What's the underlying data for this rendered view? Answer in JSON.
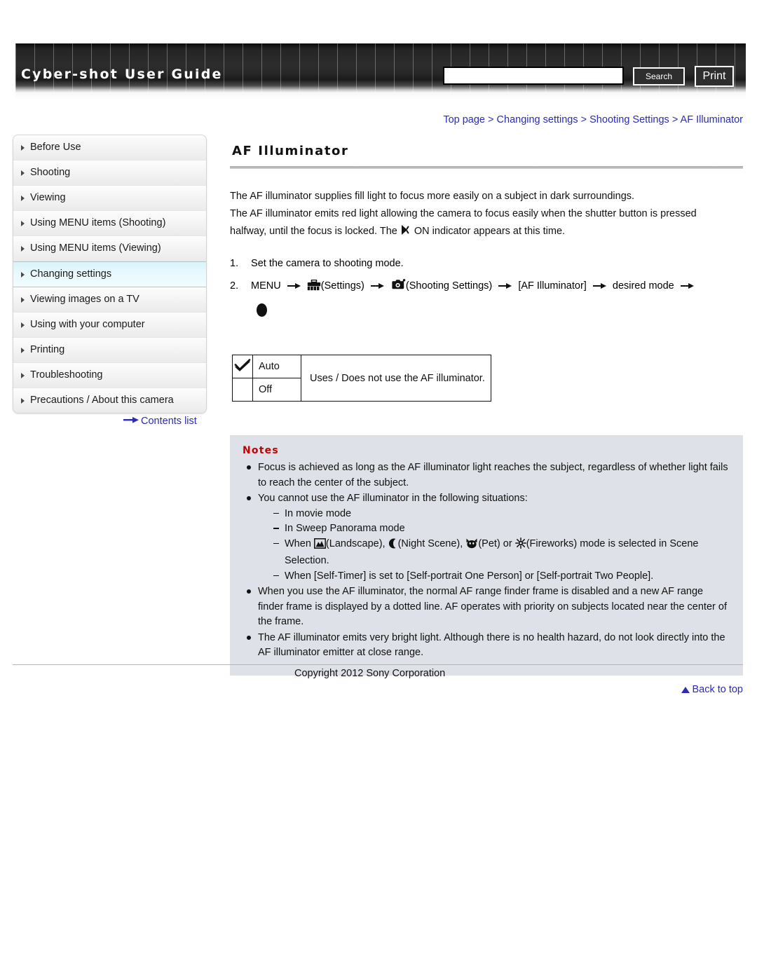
{
  "header": {
    "site_title": "Cyber-shot User Guide",
    "search_value": "",
    "search_placeholder": "",
    "search_button": "Search",
    "print_button": "Print"
  },
  "breadcrumb": {
    "items": [
      {
        "label": "Top page"
      },
      {
        "label": "Changing settings"
      },
      {
        "label": "Shooting Settings"
      },
      {
        "label": "AF Illuminator"
      }
    ],
    "separator": ">"
  },
  "sidebar": {
    "items": [
      {
        "label": "Before Use",
        "active": false
      },
      {
        "label": "Shooting",
        "active": false
      },
      {
        "label": "Viewing",
        "active": false
      },
      {
        "label": "Using MENU items (Shooting)",
        "active": false
      },
      {
        "label": "Using MENU items (Viewing)",
        "active": false
      },
      {
        "label": "Changing settings",
        "active": true
      },
      {
        "label": "Viewing images on a TV",
        "active": false
      },
      {
        "label": "Using with your computer",
        "active": false
      },
      {
        "label": "Printing",
        "active": false
      },
      {
        "label": "Troubleshooting",
        "active": false
      },
      {
        "label": "Precautions / About this camera",
        "active": false
      }
    ],
    "contents_link": "Contents list"
  },
  "main": {
    "title": "AF Illuminator",
    "paragraph_1": "The AF illuminator supplies fill light to focus more easily on a subject in dark surroundings.",
    "paragraph_2": "The AF illuminator emits red light allowing the camera to focus easily when the shutter button is pressed",
    "paragraph_3_before": "halfway, until the focus is locked. The",
    "paragraph_3_icon_label": "ON",
    "paragraph_3_after": "indicator appears at this time.",
    "steps": [
      {
        "number": "1.",
        "text": "Set the camera to shooting mode."
      },
      {
        "number": "2.",
        "menu_label": "MENU",
        "settings_label": "(Settings)",
        "shooting_settings_label": "(Shooting Settings)",
        "item_label": "[AF Illuminator]",
        "desired_mode_label": "desired mode"
      }
    ],
    "options_table": {
      "rows": [
        {
          "checked": true,
          "name": "Auto"
        },
        {
          "checked": false,
          "name": "Off"
        }
      ],
      "description": "Uses / Does not use the AF illuminator."
    },
    "notes": {
      "title": "Notes",
      "items": [
        {
          "text": "Focus is achieved as long as the AF illuminator light reaches the subject, regardless of whether light fails to reach the center of the subject.",
          "sub_items": []
        },
        {
          "text": "You cannot use the AF illuminator in the following situations:",
          "sub_items": [
            {
              "text": "In movie mode"
            },
            {
              "text": "In Sweep Panorama mode"
            },
            {
              "rich": true,
              "before": "When",
              "icon1_label": "(Landscape),",
              "icon2_label": "(Night Scene),",
              "icon3_label": "(Pet) or",
              "icon4_label": "(Fireworks) mode is selected in Scene",
              "after": "Selection."
            },
            {
              "text": "When [Self-Timer] is set to [Self-portrait One Person] or [Self-portrait Two People]."
            }
          ]
        },
        {
          "text": "When you use the AF illuminator, the normal AF range finder frame is disabled and a new AF range finder frame is displayed by a dotted line. AF operates with priority on subjects located near the center of the frame.",
          "sub_items": []
        },
        {
          "text": "The AF illuminator emits very bright light. Although there is no health hazard, do not look directly into the AF illuminator emitter at close range.",
          "sub_items": []
        }
      ]
    }
  },
  "footer": {
    "back_to_top": "Back to top",
    "copyright": "Copyright 2012 Sony Corporation"
  },
  "colors": {
    "link": "#2b2bb5",
    "notes_title": "#c30000",
    "notes_bg": "#dfe1e8",
    "active_nav": "#d8f3fa"
  }
}
